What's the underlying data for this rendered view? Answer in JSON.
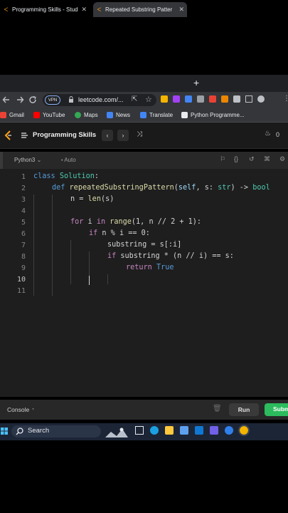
{
  "browser": {
    "tabs": [
      {
        "title": "Programming Skills - Stud",
        "close": "✕"
      },
      {
        "title": "Repeated Substring Patter",
        "close": "✕"
      }
    ],
    "new_tab": "+",
    "vpn_badge": "VPN",
    "url": "leetcode.com/...",
    "bookmarks": [
      {
        "label": "Gmail",
        "color": "#ea4335"
      },
      {
        "label": "YouTube",
        "color": "#ff0000"
      },
      {
        "label": "Maps",
        "color": "#34a853"
      },
      {
        "label": "News",
        "color": "#4285f4"
      },
      {
        "label": "Translate",
        "color": "#4285f4"
      },
      {
        "label": "Python Programme...",
        "color": "#e8eaed"
      }
    ]
  },
  "leetcode": {
    "section_title": "Programming Skills",
    "streak_count": "0",
    "language": "Python3",
    "autosave": "Auto",
    "code_lines": [
      "1",
      "2",
      "3",
      "4",
      "5",
      "6",
      "7",
      "8",
      "9",
      "10",
      "11"
    ],
    "code": {
      "l1_kw": "class",
      "l1_name": "Solution",
      "l1_colon": ":",
      "l2_kw": "def",
      "l2_fn": "repeatedSubstringPattern",
      "l2_rest1": "(",
      "l2_self": "self",
      "l2_rest2": ", s: ",
      "l2_type": "str",
      "l2_rest3": ") -> ",
      "l2_ret": "bool",
      "l3_a": "n = ",
      "l3_fn": "len",
      "l3_b": "(s)",
      "l5_for": "for",
      "l5_a": " i ",
      "l5_in": "in",
      "l5_sp": " ",
      "l5_fn": "range",
      "l5_b": "(1, n // 2 + 1):",
      "l6_if": "if",
      "l6_a": " n % i == 0:",
      "l7": "substring = s[:i]",
      "l8_if": "if",
      "l8_a": " substring * (n // i) == s:",
      "l9_ret": "return",
      "l9_sp": " ",
      "l9_true": "True"
    },
    "console_label": "Console",
    "run_label": "Run",
    "submit_label": "Submit"
  },
  "taskbar": {
    "search_label": "Search"
  }
}
